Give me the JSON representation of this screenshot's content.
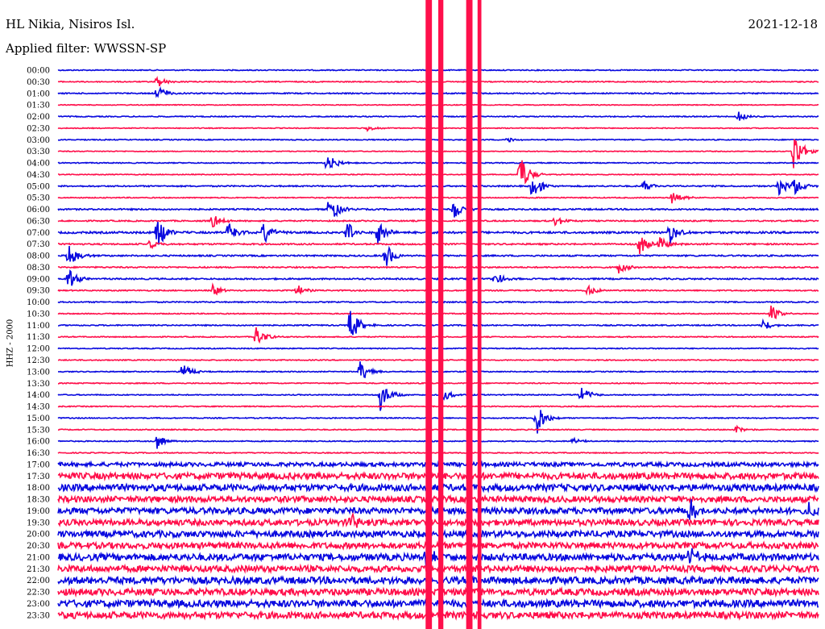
{
  "header": {
    "station": "HL Nikia, Nisiros Isl.",
    "filter_line": "Applied filter: WWSSN-SP",
    "date": "2021-12-18"
  },
  "chart_data": {
    "type": "line",
    "title": "HL Nikia, Nisiros Isl.",
    "subtitle": "Applied filter: WWSSN-SP",
    "date": "2021-12-18",
    "ylabel": "HHZ - 2000",
    "xlabel": "",
    "x_unit": "minutes past row start",
    "xlim": [
      0,
      30
    ],
    "colors": {
      "even_rows": "#0a0adf",
      "odd_rows": "#ff0f4b"
    },
    "rows": [
      "00:00",
      "00:30",
      "01:00",
      "01:30",
      "02:00",
      "02:30",
      "03:00",
      "03:30",
      "04:00",
      "04:30",
      "05:00",
      "05:30",
      "06:00",
      "06:30",
      "07:00",
      "07:30",
      "08:00",
      "08:30",
      "09:00",
      "09:30",
      "10:00",
      "10:30",
      "11:00",
      "11:30",
      "12:00",
      "12:30",
      "13:00",
      "13:30",
      "14:00",
      "14:30",
      "15:00",
      "15:30",
      "16:00",
      "16:30",
      "17:00",
      "17:30",
      "18:00",
      "18:30",
      "19:00",
      "19:30",
      "20:00",
      "20:30",
      "21:00",
      "21:30",
      "22:00",
      "22:30",
      "23:00",
      "23:30"
    ],
    "noise_level": [
      0.6,
      0.6,
      0.7,
      0.5,
      0.6,
      0.5,
      0.6,
      0.5,
      0.6,
      0.5,
      0.8,
      0.6,
      0.9,
      0.8,
      1.2,
      0.9,
      0.9,
      0.8,
      0.9,
      0.7,
      0.7,
      0.6,
      0.7,
      0.6,
      0.6,
      0.6,
      0.6,
      0.6,
      0.6,
      0.6,
      0.6,
      0.6,
      0.6,
      0.6,
      2.4,
      3.8,
      4.0,
      3.6,
      3.7,
      3.6,
      3.8,
      3.7,
      4.1,
      3.8,
      4.2,
      4.0,
      4.3,
      4.0
    ],
    "events": [
      {
        "row": "00:30",
        "x": 3.9,
        "amp": 8
      },
      {
        "row": "01:00",
        "x": 3.9,
        "amp": 12
      },
      {
        "row": "02:00",
        "x": 26.8,
        "amp": 8
      },
      {
        "row": "02:30",
        "x": 12.2,
        "amp": 4
      },
      {
        "row": "03:00",
        "x": 17.7,
        "amp": 4
      },
      {
        "row": "03:30",
        "x": 29.0,
        "amp": 30
      },
      {
        "row": "04:00",
        "x": 10.6,
        "amp": 15
      },
      {
        "row": "04:30",
        "x": 18.2,
        "amp": 30
      },
      {
        "row": "05:00",
        "x": 18.7,
        "amp": 20
      },
      {
        "row": "05:00",
        "x": 23.1,
        "amp": 7
      },
      {
        "row": "05:00",
        "x": 28.4,
        "amp": 12
      },
      {
        "row": "05:00",
        "x": 29.0,
        "amp": 14
      },
      {
        "row": "05:30",
        "x": 24.2,
        "amp": 12
      },
      {
        "row": "06:00",
        "x": 10.7,
        "amp": 20
      },
      {
        "row": "06:00",
        "x": 15.6,
        "amp": 15
      },
      {
        "row": "06:30",
        "x": 6.1,
        "amp": 10
      },
      {
        "row": "06:30",
        "x": 19.6,
        "amp": 8
      },
      {
        "row": "07:00",
        "x": 3.9,
        "amp": 25
      },
      {
        "row": "07:00",
        "x": 6.7,
        "amp": 18
      },
      {
        "row": "07:00",
        "x": 8.1,
        "amp": 15
      },
      {
        "row": "07:00",
        "x": 11.4,
        "amp": 16
      },
      {
        "row": "07:00",
        "x": 12.6,
        "amp": 18
      },
      {
        "row": "07:00",
        "x": 24.1,
        "amp": 18
      },
      {
        "row": "07:30",
        "x": 3.6,
        "amp": 8
      },
      {
        "row": "07:30",
        "x": 22.9,
        "amp": 16
      },
      {
        "row": "07:30",
        "x": 23.7,
        "amp": 12
      },
      {
        "row": "08:00",
        "x": 0.4,
        "amp": 18
      },
      {
        "row": "08:00",
        "x": 12.9,
        "amp": 18
      },
      {
        "row": "08:30",
        "x": 22.1,
        "amp": 8
      },
      {
        "row": "09:00",
        "x": 0.4,
        "amp": 15
      },
      {
        "row": "09:00",
        "x": 17.2,
        "amp": 10
      },
      {
        "row": "09:30",
        "x": 6.1,
        "amp": 8
      },
      {
        "row": "09:30",
        "x": 9.4,
        "amp": 8
      },
      {
        "row": "09:30",
        "x": 20.9,
        "amp": 8
      },
      {
        "row": "10:30",
        "x": 28.1,
        "amp": 12
      },
      {
        "row": "11:00",
        "x": 11.5,
        "amp": 25
      },
      {
        "row": "11:00",
        "x": 27.8,
        "amp": 8
      },
      {
        "row": "11:30",
        "x": 7.8,
        "amp": 16
      },
      {
        "row": "13:00",
        "x": 4.9,
        "amp": 14
      },
      {
        "row": "13:00",
        "x": 11.9,
        "amp": 16
      },
      {
        "row": "14:00",
        "x": 12.7,
        "amp": 22
      },
      {
        "row": "14:00",
        "x": 20.6,
        "amp": 14
      },
      {
        "row": "14:00",
        "x": 15.2,
        "amp": 8
      },
      {
        "row": "15:00",
        "x": 18.8,
        "amp": 30
      },
      {
        "row": "15:30",
        "x": 26.7,
        "amp": 6
      },
      {
        "row": "16:00",
        "x": 3.9,
        "amp": 10
      },
      {
        "row": "16:00",
        "x": 20.3,
        "amp": 5
      },
      {
        "row": "19:00",
        "x": 24.9,
        "amp": 20
      },
      {
        "row": "19:00",
        "x": 29.6,
        "amp": 14
      },
      {
        "row": "19:30",
        "x": 11.5,
        "amp": 14
      },
      {
        "row": "21:00",
        "x": 14.5,
        "amp": 18
      },
      {
        "row": "21:00",
        "x": 24.9,
        "amp": 14
      }
    ],
    "saturated_bursts": [
      {
        "x_start": 14.5,
        "x_end": 14.75
      },
      {
        "x_start": 15.0,
        "x_end": 15.2
      },
      {
        "x_start": 16.1,
        "x_end": 16.35
      },
      {
        "x_start": 16.55,
        "x_end": 16.7
      }
    ]
  }
}
